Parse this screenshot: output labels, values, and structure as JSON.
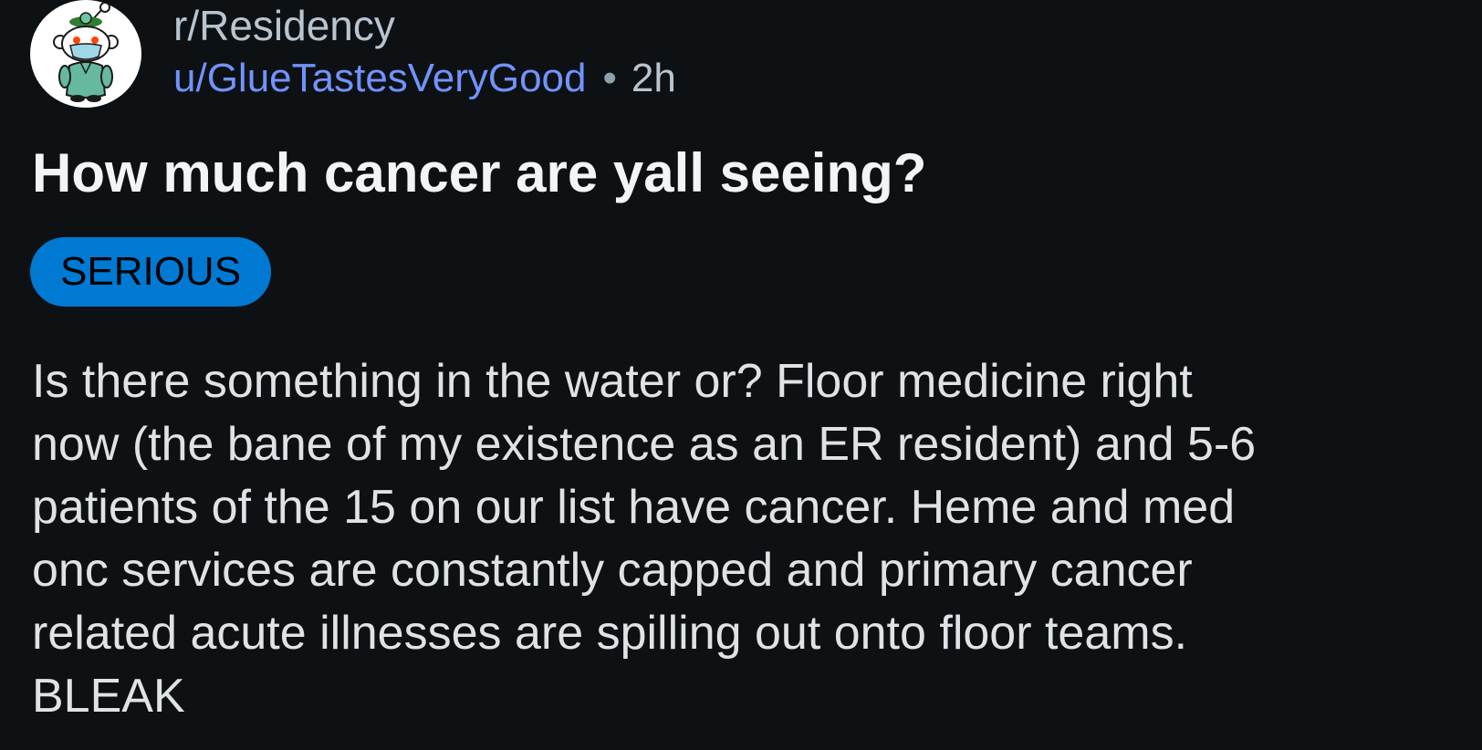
{
  "post": {
    "subreddit": "r/Residency",
    "username": "u/GlueTastesVeryGood",
    "separator": "•",
    "age": "2h",
    "title": "How much cancer are yall seeing?",
    "flair": "SERIOUS",
    "body_lines": [
      "Is there something in the water or? Floor medicine right",
      "now (the bane of my existence as an ER resident) and 5-6",
      "patients of the 15 on our list have cancer. Heme and med",
      "onc services are constantly capped and primary cancer",
      "related acute illnesses are spilling out onto floor teams.",
      "BLEAK"
    ],
    "avatar_icon": "reddit-snoo-doctor-icon"
  },
  "colors": {
    "background": "#0e1113",
    "username": "#7193ff",
    "flair_bg": "#0079d3",
    "title": "#f2f4f5",
    "meta": "#b8c5d0"
  }
}
